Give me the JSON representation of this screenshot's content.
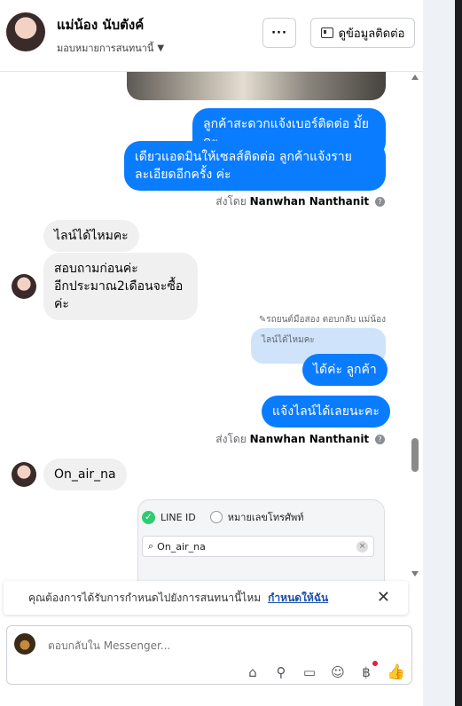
{
  "header": {
    "contact_name": "แม่น้อง นับตังค์",
    "assign_label": "มอบหมายการสนทนานี้",
    "more_label": "···",
    "contact_info_label": "ดูข้อมูลติดต่อ"
  },
  "messages": {
    "out1": "ลูกค้าสะดวกแจ้งเบอร์ติดต่อ มั้ยคะ",
    "out2_line1": "เดียวแอดมินให้เซลส์ติดต่อ ลูกค้าแจ้งราย",
    "out2_line2": "ละเอียดอีกครั้ง ค่ะ",
    "sent_by_prefix": "ส่งโดย",
    "sender": "Nanwhan Nanthanit",
    "in1": "ไลน์ได้ไหมคะ",
    "in2_line1": "สอบถามก่อนค่ะ",
    "in2_line2": "อีกประมาณ2เดือนจะซื้อค่ะ",
    "reply_note": "รถยนต์มือสอง ตอบกลับ แม่น้อง",
    "quoted": "ไลน์ได้ไหมคะ",
    "out3": "ได้ค่ะ  ลูกค้า",
    "out4": "แจ้งไลน์ได้เลยนะคะ",
    "in3": "On_air_na",
    "shot_line_id": "LINE ID",
    "shot_phone": "หมายเลขโทรศัพท์",
    "shot_search_value": "On_air_na"
  },
  "notification": {
    "text": "คุณต้องการได้รับการกำหนดไปยังการสนทนานี้ไหม",
    "link": "กำหนดให้ฉัน"
  },
  "composer": {
    "placeholder": "ตอบกลับใน Messenger..."
  },
  "colors": {
    "outgoing_bubble": "#0a7cff",
    "incoming_bubble": "#f0f0f0",
    "quoted_bubble": "#cfe3fb"
  }
}
